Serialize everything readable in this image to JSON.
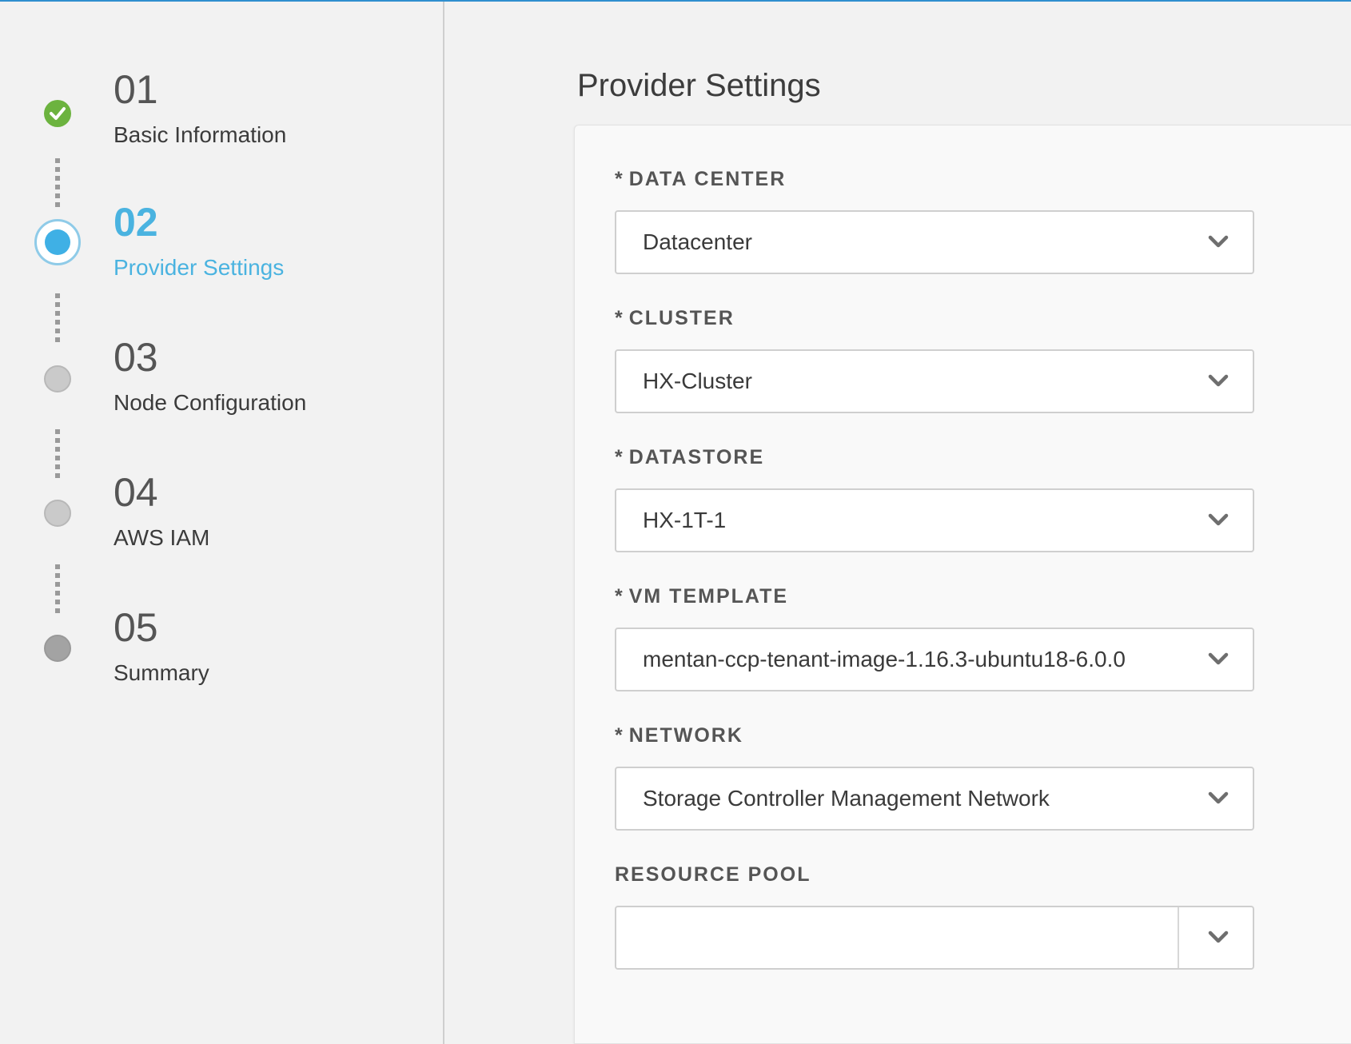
{
  "wizard": {
    "steps": [
      {
        "number": "01",
        "label": "Basic Information",
        "status": "completed"
      },
      {
        "number": "02",
        "label": "Provider Settings",
        "status": "current"
      },
      {
        "number": "03",
        "label": "Node Configuration",
        "status": "pending"
      },
      {
        "number": "04",
        "label": "AWS IAM",
        "status": "pending"
      },
      {
        "number": "05",
        "label": "Summary",
        "status": "pending"
      }
    ]
  },
  "main": {
    "title": "Provider Settings",
    "fields": [
      {
        "required_mark": "*",
        "label": "DATA CENTER",
        "value": "Datacenter"
      },
      {
        "required_mark": "*",
        "label": "CLUSTER",
        "value": "HX-Cluster"
      },
      {
        "required_mark": "*",
        "label": "DATASTORE",
        "value": "HX-1T-1"
      },
      {
        "required_mark": "*",
        "label": "VM TEMPLATE",
        "value": "mentan-ccp-tenant-image-1.16.3-ubuntu18-6.0.0"
      },
      {
        "required_mark": "*",
        "label": "NETWORK",
        "value": "Storage Controller Management Network"
      },
      {
        "required_mark": "",
        "label": "RESOURCE POOL",
        "value": ""
      }
    ]
  },
  "colors": {
    "accent": "#3fb0e5",
    "completed": "#6cb33f",
    "pending": "#cacaca",
    "top_bar": "#2f8fcf"
  },
  "icons": {
    "completed_step": "check-icon",
    "dropdown": "chevron-down-icon"
  }
}
